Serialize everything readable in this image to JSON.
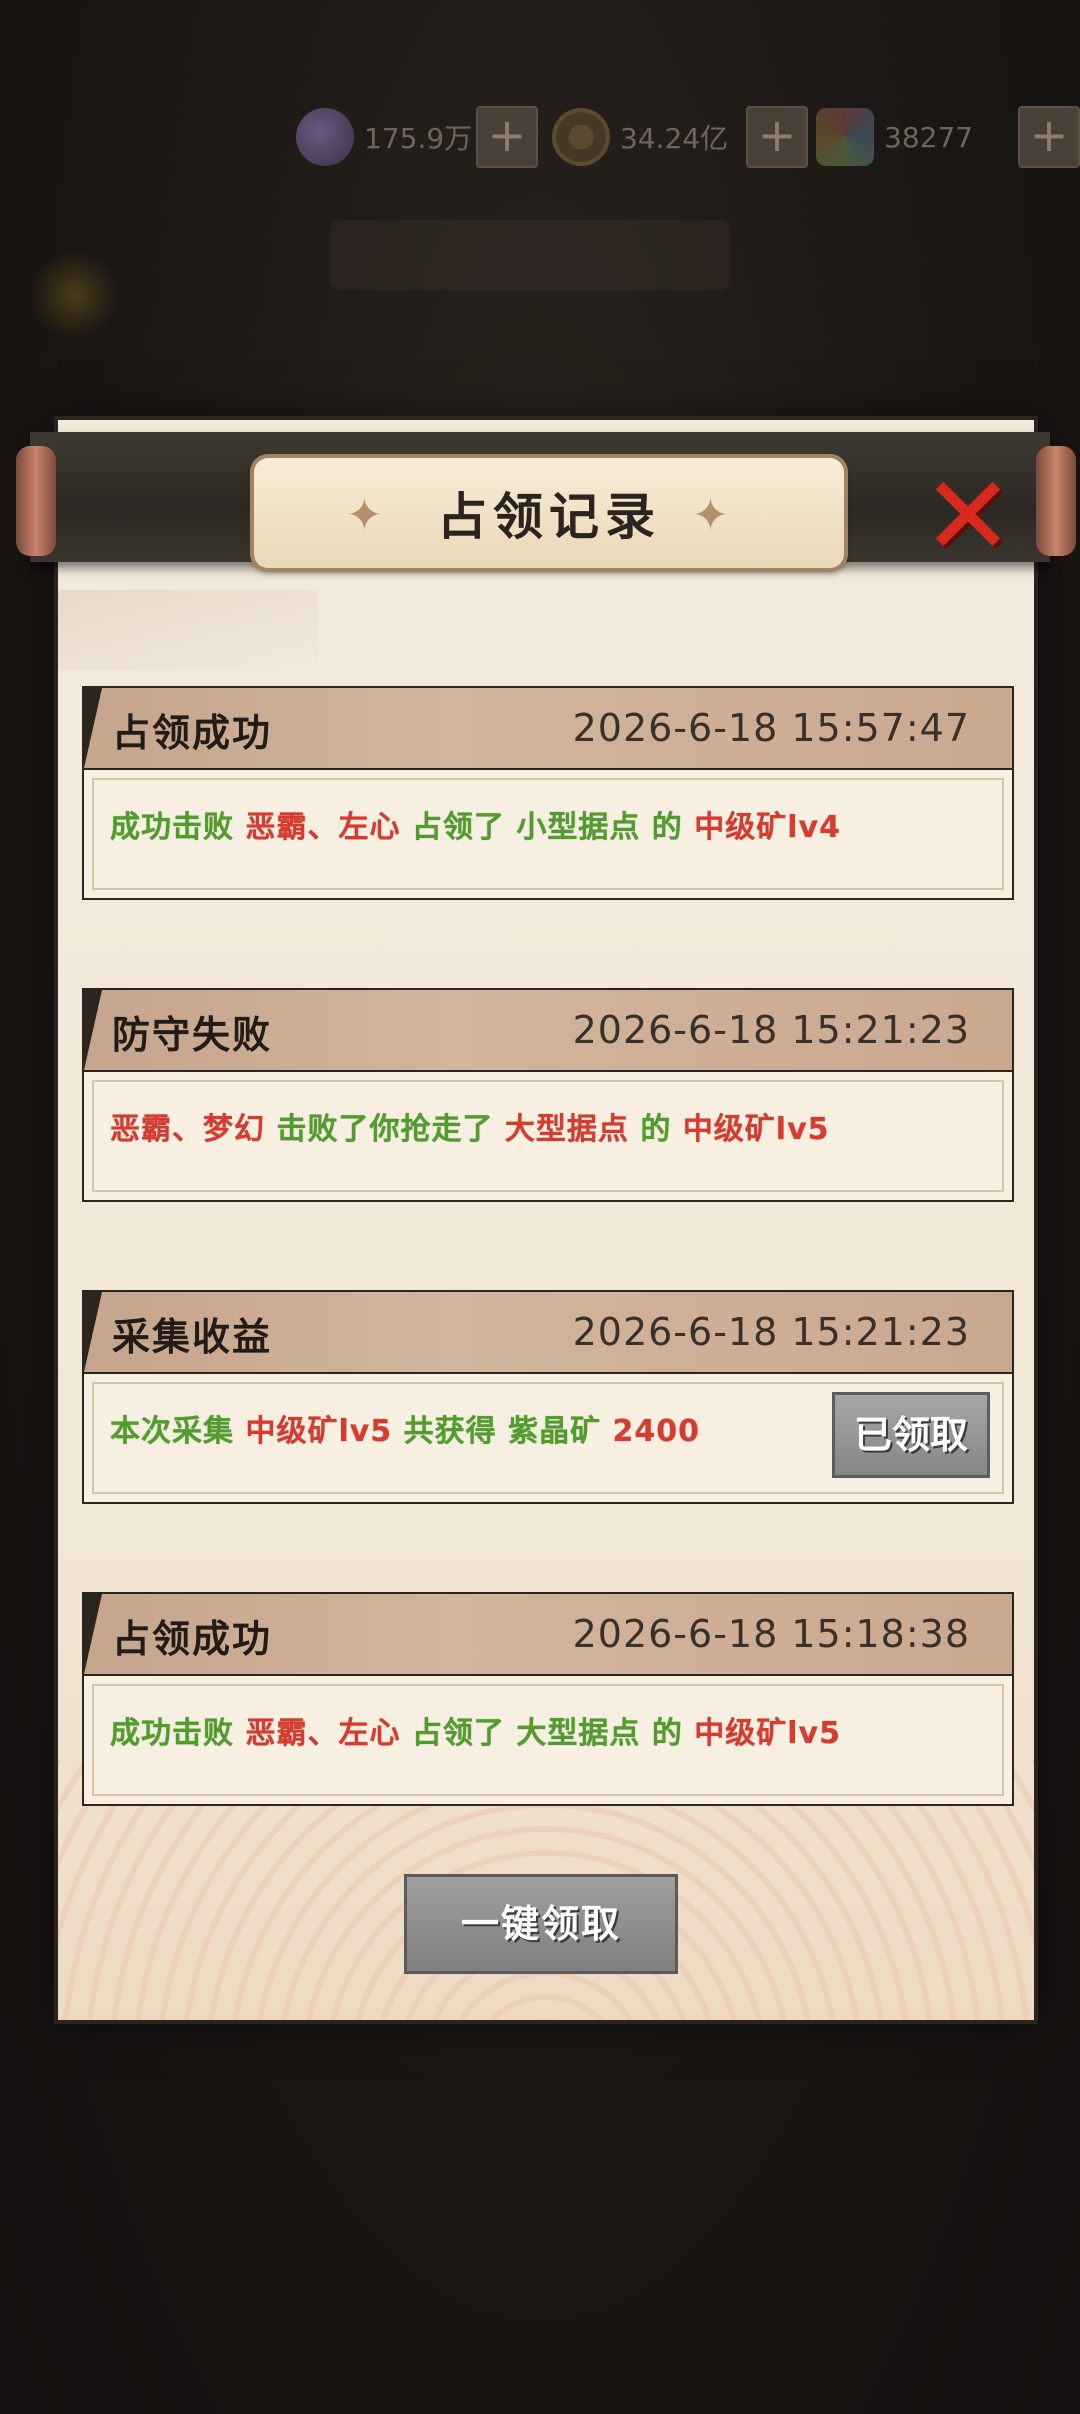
{
  "resources": [
    {
      "icon": "purple-crystal-icon",
      "value": "175.9万"
    },
    {
      "icon": "coin-icon",
      "value": "34.24亿"
    },
    {
      "icon": "gem-icon",
      "value": "38277"
    }
  ],
  "plus_label": "+",
  "dialog": {
    "title": "占领记录",
    "close_label": "✕"
  },
  "records": [
    {
      "type": "占领成功",
      "time": "2026-6-18  15:57:47",
      "segments": [
        {
          "text": "成功击败 ",
          "color": "g"
        },
        {
          "text": "恶霸、左心 ",
          "color": "r"
        },
        {
          "text": "占领了 小型据点 ",
          "color": "g"
        },
        {
          "text": "的 ",
          "color": "g"
        },
        {
          "text": "中级矿lv4",
          "color": "r"
        }
      ]
    },
    {
      "type": "防守失败",
      "time": "2026-6-18  15:21:23",
      "segments": [
        {
          "text": "恶霸、梦幻 ",
          "color": "r"
        },
        {
          "text": "击败了你抢走了 ",
          "color": "g"
        },
        {
          "text": "大型据点 ",
          "color": "r"
        },
        {
          "text": "的 ",
          "color": "g"
        },
        {
          "text": "中级矿lv5",
          "color": "r"
        }
      ]
    },
    {
      "type": "采集收益",
      "time": "2026-6-18  15:21:23",
      "segments": [
        {
          "text": "本次采集 ",
          "color": "g"
        },
        {
          "text": "中级矿lv5 ",
          "color": "r"
        },
        {
          "text": "共获得 紫晶矿 ",
          "color": "g"
        },
        {
          "text": "2400",
          "color": "r"
        }
      ],
      "button": "已领取"
    },
    {
      "type": "占领成功",
      "time": "2026-6-18  15:18:38",
      "segments": [
        {
          "text": "成功击败 ",
          "color": "g"
        },
        {
          "text": "恶霸、左心 ",
          "color": "r"
        },
        {
          "text": "占领了 ",
          "color": "g"
        },
        {
          "text": "大型据点 ",
          "color": "g"
        },
        {
          "text": "的 ",
          "color": "g"
        },
        {
          "text": "中级矿lv5",
          "color": "r"
        }
      ]
    }
  ],
  "claim_all_label": "一键领取",
  "colors": {
    "success_text": "#4f9e2a",
    "highlight_text": "#d93a2e",
    "close": "#d62a1e"
  }
}
